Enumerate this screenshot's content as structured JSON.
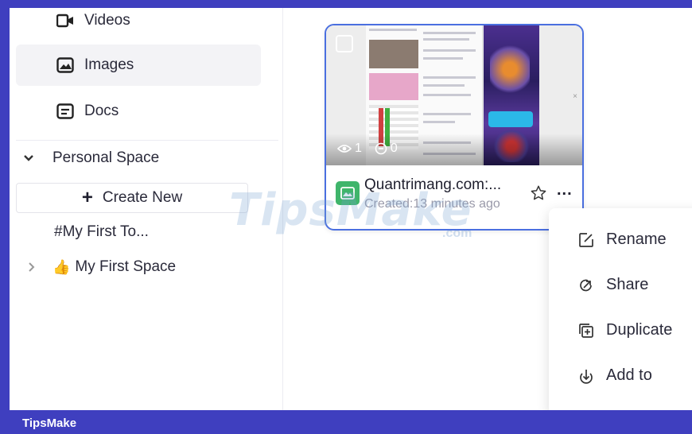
{
  "sidebar": {
    "items": [
      {
        "label": "Videos",
        "icon": "video-icon"
      },
      {
        "label": "Images",
        "icon": "image-icon"
      },
      {
        "label": "Docs",
        "icon": "doc-icon"
      }
    ],
    "section": {
      "label": "Personal Space"
    },
    "create_label": "Create New",
    "page_link": "#My First To...",
    "space": {
      "emoji": "👍",
      "label": "My First Space"
    }
  },
  "card": {
    "views": "1",
    "comments": "0",
    "name": "Quantrimang.com:...",
    "created": "Created:13 minutes ago",
    "more": "..."
  },
  "context_menu": {
    "items": [
      {
        "label": "Rename",
        "icon": "rename-icon"
      },
      {
        "label": "Share",
        "icon": "share-icon"
      },
      {
        "label": "Duplicate",
        "icon": "duplicate-icon"
      },
      {
        "label": "Add to",
        "icon": "add-to-icon"
      }
    ]
  },
  "watermark": {
    "text": "TipsMake",
    "suffix": ".com"
  },
  "footer": {
    "brand": "TipsMake"
  },
  "colors": {
    "frame": "#3f3fbf",
    "card_border": "#4a6fe0",
    "file_icon": "#3fb56b"
  }
}
